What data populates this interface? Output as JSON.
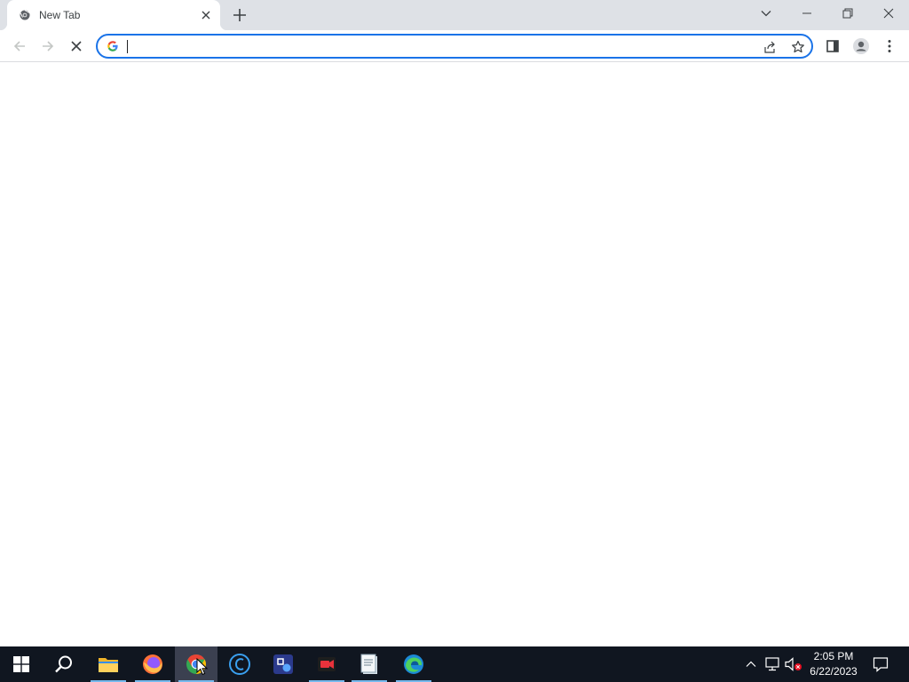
{
  "browser": {
    "tab": {
      "title": "New Tab",
      "favicon": "chrome-favicon-icon"
    },
    "window_controls": [
      "tab-search-icon",
      "minimize-icon",
      "restore-icon",
      "close-window-icon"
    ],
    "toolbar": {
      "buttons": [
        "back-icon",
        "forward-icon",
        "stop-icon"
      ],
      "omnibox": {
        "value": "",
        "placeholder": "",
        "prefix_icon": "google-g-icon"
      },
      "omnibox_actions": [
        "share-icon",
        "bookmark-star-icon"
      ],
      "right_buttons": [
        "side-panel-icon",
        "profile-icon",
        "menu-kebab-icon"
      ]
    }
  },
  "taskbar": {
    "apps": [
      {
        "name": "Start",
        "icon": "windows-start-icon"
      },
      {
        "name": "Search",
        "icon": "search-icon"
      },
      {
        "name": "File Explorer",
        "icon": "folder-icon"
      },
      {
        "name": "Firefox",
        "icon": "firefox-icon"
      },
      {
        "name": "Chrome",
        "icon": "chrome-icon",
        "active": true
      },
      {
        "name": "CCleaner",
        "icon": "ccleaner-icon"
      },
      {
        "name": "App",
        "icon": "app-icon"
      },
      {
        "name": "Recorder",
        "icon": "recorder-icon"
      },
      {
        "name": "Notepad",
        "icon": "notepad-icon"
      },
      {
        "name": "Edge",
        "icon": "edge-icon"
      }
    ],
    "tray": [
      "chevron-up-icon",
      "network-icon",
      "volume-muted-icon"
    ],
    "clock": {
      "time": "2:05 PM",
      "date": "6/22/2023"
    },
    "notification_icon": "notification-icon"
  },
  "colors": {
    "accent": "#1a73e8",
    "tabstrip": "#dee1e6",
    "taskbar": "#101620",
    "taskbar_active": "#3b4050"
  }
}
